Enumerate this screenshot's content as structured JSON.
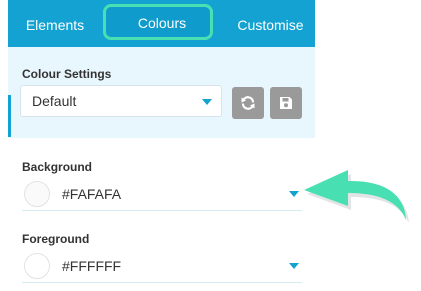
{
  "tabs": {
    "elements": "Elements",
    "colours": "Colours",
    "customise": "Customise"
  },
  "colour_settings": {
    "label": "Colour Settings",
    "selected": "Default",
    "refresh_icon": "refresh-icon",
    "save_icon": "save-icon"
  },
  "background": {
    "label": "Background",
    "value": "#FAFAFA"
  },
  "foreground": {
    "label": "Foreground",
    "value": "#FFFFFF"
  },
  "colors": {
    "brand": "#13a2d1",
    "highlight": "#48e0b2",
    "settings_bg": "#e8f7fd"
  }
}
